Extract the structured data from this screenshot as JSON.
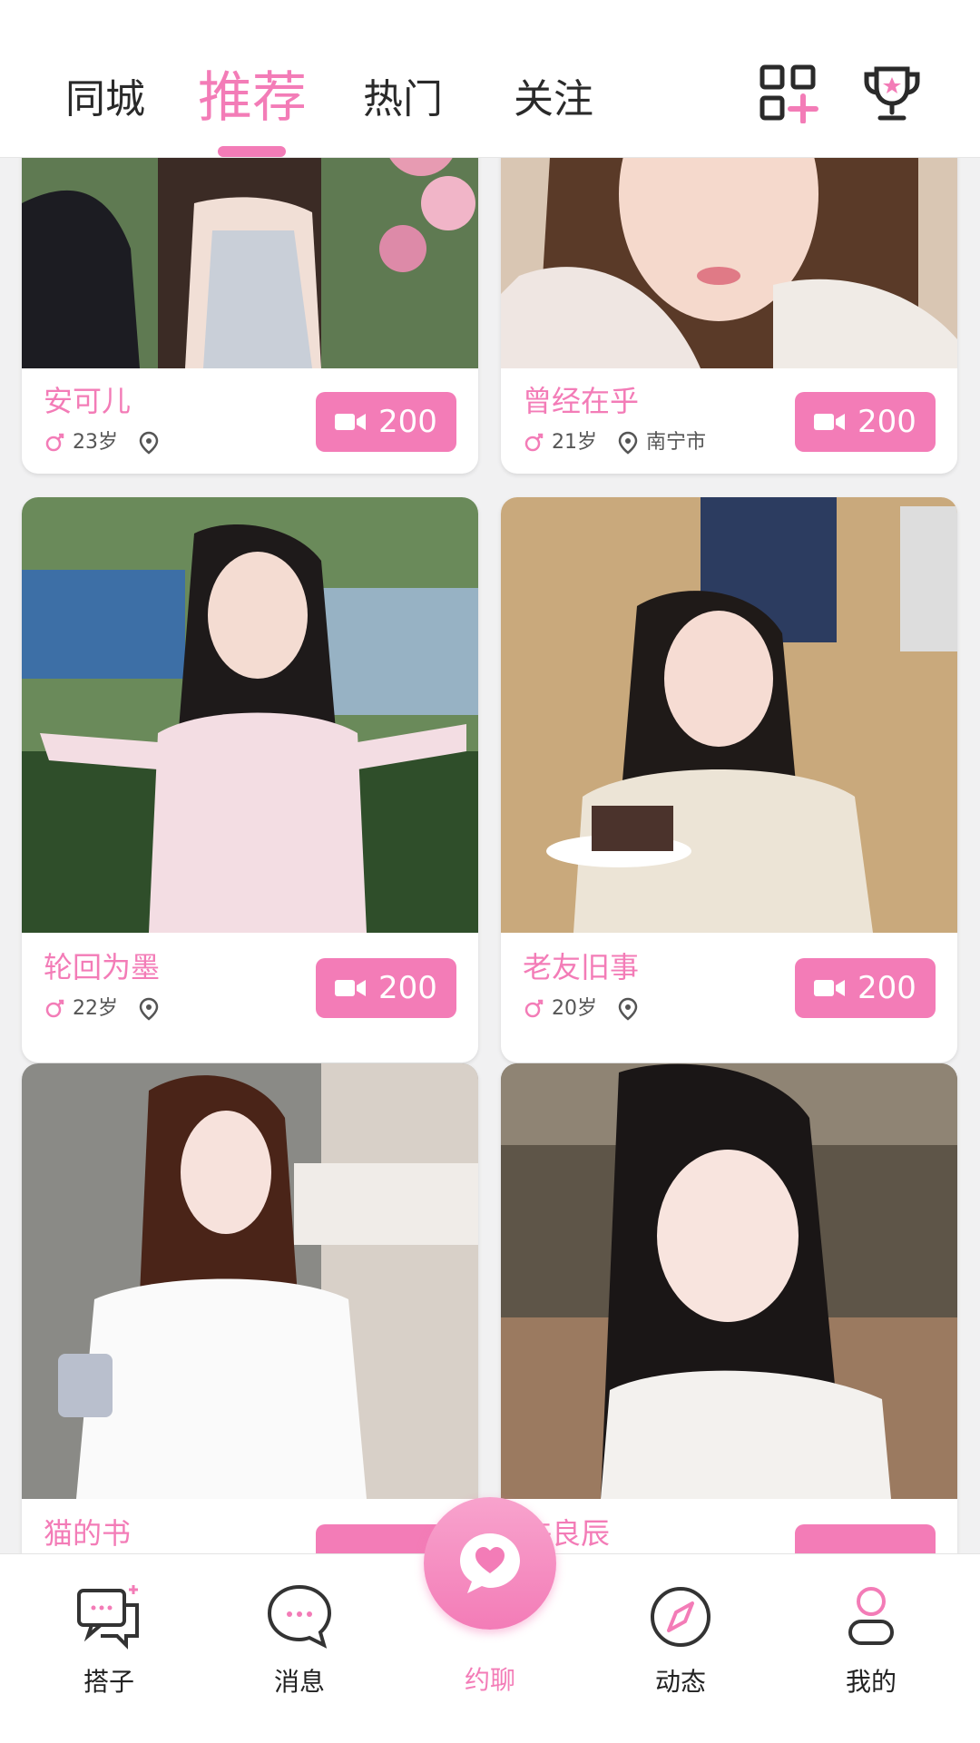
{
  "header": {
    "tabs": [
      "同城",
      "推荐",
      "热门",
      "关注"
    ],
    "active_tab": "推荐",
    "icons": [
      "grid-add-icon",
      "trophy-icon"
    ]
  },
  "cards": [
    {
      "name": "安可儿",
      "age": "23岁",
      "location": "",
      "price": "200"
    },
    {
      "name": "曾经在乎",
      "age": "21岁",
      "location": "南宁市",
      "price": "200"
    },
    {
      "name": "轮回为墨",
      "age": "22岁",
      "location": "",
      "price": "200"
    },
    {
      "name": "老友旧事",
      "age": "20岁",
      "location": "",
      "price": "200"
    },
    {
      "name": "猫的书",
      "age": "",
      "location": "",
      "price": ""
    },
    {
      "name": "许良辰",
      "age": "",
      "location": "",
      "price": ""
    }
  ],
  "nav": [
    {
      "label": "搭子",
      "icon": "chat-bubbles-icon"
    },
    {
      "label": "消息",
      "icon": "message-dots-icon"
    },
    {
      "label": "约聊",
      "icon": "heart-chat-icon"
    },
    {
      "label": "动态",
      "icon": "compass-icon"
    },
    {
      "label": "我的",
      "icon": "person-icon"
    }
  ],
  "colors": {
    "accent": "#f37cb7",
    "text": "#2a2a2a"
  }
}
